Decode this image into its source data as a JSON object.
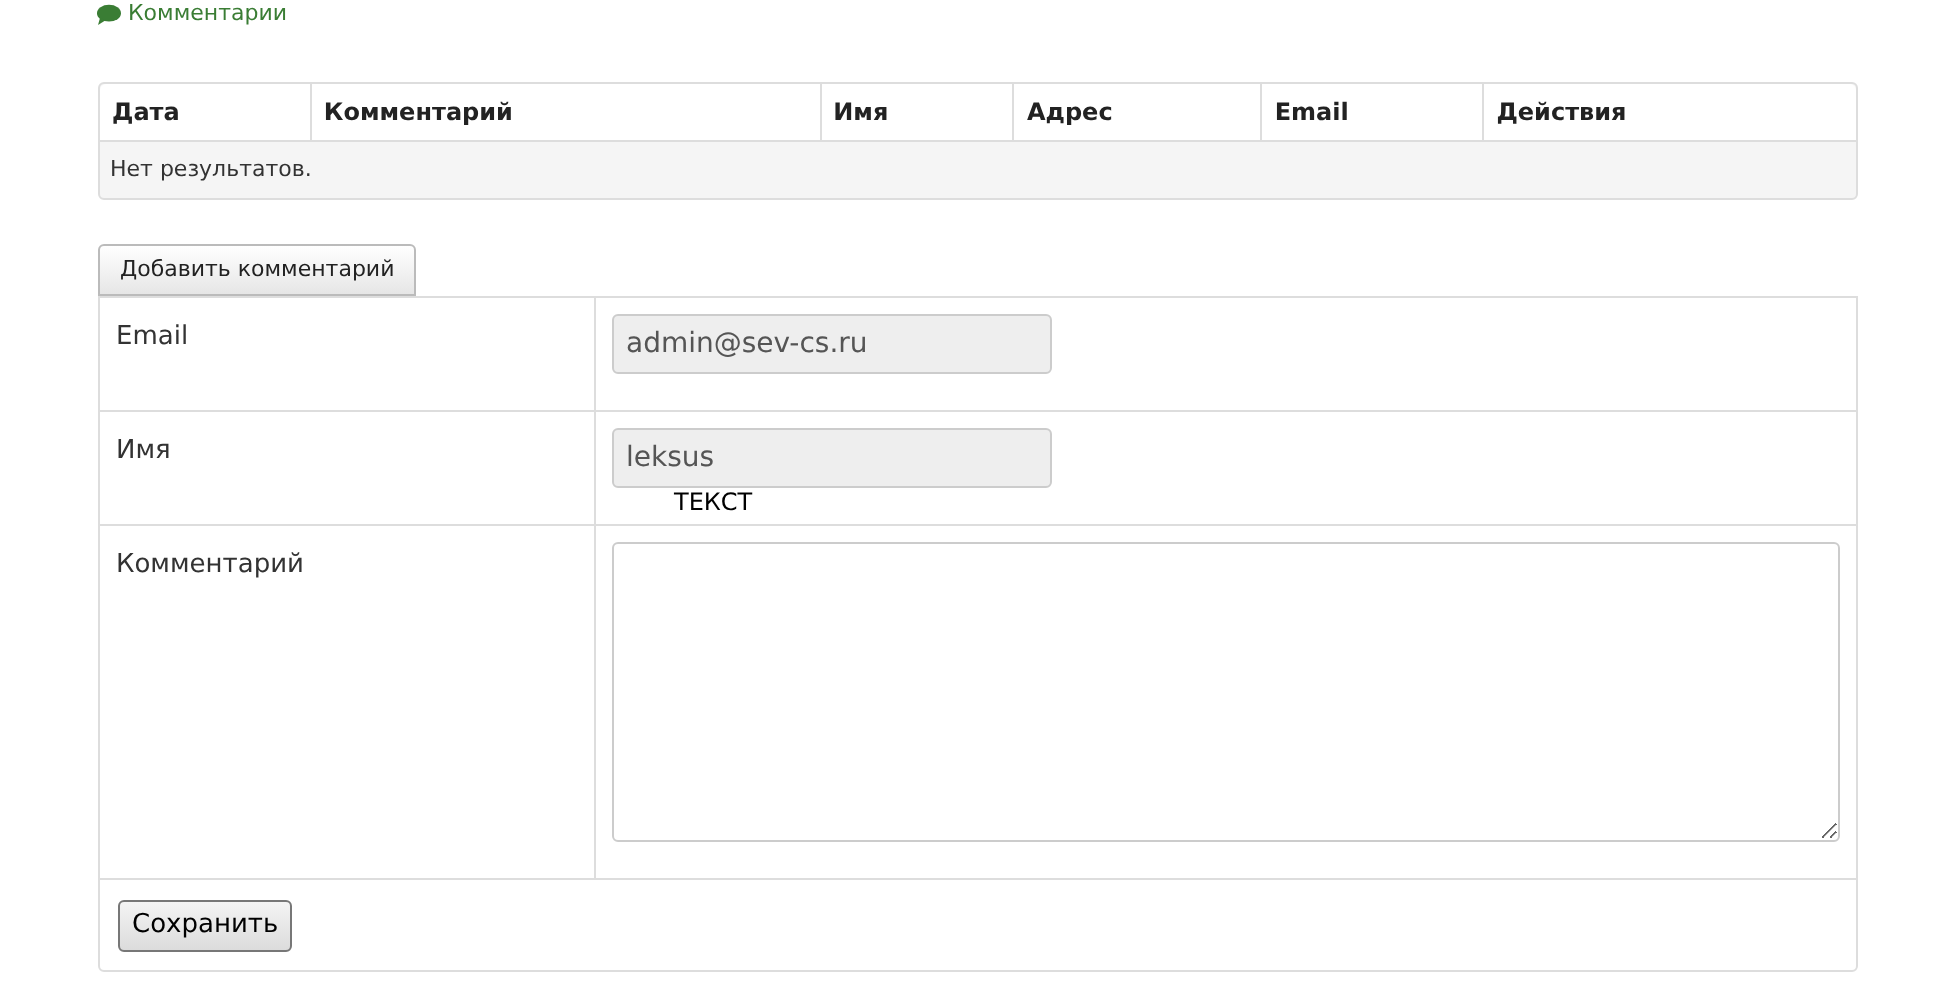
{
  "section_link": {
    "label": "Комментарии"
  },
  "table": {
    "columns": [
      "Дата",
      "Комментарий",
      "Имя",
      "Адрес",
      "Email",
      "Действия"
    ],
    "empty_message": "Нет результатов."
  },
  "add_button": "Добавить комментарий",
  "form": {
    "fields": [
      {
        "kind": "input",
        "label": "Email",
        "value": "admin@sev-cs.ru",
        "disabled": true
      },
      {
        "kind": "input",
        "label": "Имя",
        "value": "leksus",
        "disabled": true,
        "note": "ТЕКСТ"
      },
      {
        "kind": "textarea",
        "label": "Комментарий",
        "disabled": false
      }
    ],
    "save_button": "Сохранить"
  }
}
